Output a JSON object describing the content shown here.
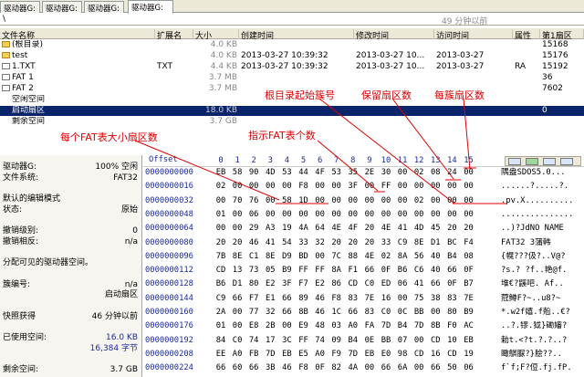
{
  "tabs": [
    {
      "label": "驱动器G:",
      "active": false
    },
    {
      "label": "驱动器G:",
      "active": false
    },
    {
      "label": "驱动器G:",
      "active": false
    },
    {
      "label": "驱动器G:",
      "active": true
    }
  ],
  "path": {
    "text": "\\",
    "time": "49 分钟以前"
  },
  "file_list": {
    "columns": [
      "文件名称",
      "扩展名",
      "大小",
      "创建时间",
      "修改时间",
      "访问时间",
      "属性",
      "第1扇区"
    ],
    "rows": [
      {
        "icon": "folder-icon",
        "name": "(根目录)",
        "ext": "",
        "size": "4.0 KB",
        "created": "",
        "modified": "",
        "accessed": "",
        "attr": "",
        "sector": "15168",
        "selected": false,
        "gray": false
      },
      {
        "icon": "folder-icon",
        "name": "test",
        "ext": "",
        "size": "4.0 KB",
        "created": "2013-03-27  10:39:32",
        "modified": "2013-03-27  10...",
        "accessed": "2013-03-27",
        "attr": "",
        "sector": "15176",
        "selected": false,
        "gray": false
      },
      {
        "icon": "file-icon",
        "name": "1.TXT",
        "ext": "TXT",
        "size": "4.4 KB",
        "created": "2013-03-27  10:39:32",
        "modified": "2013-03-27  10...",
        "accessed": "2013-03-27",
        "attr": "RA",
        "sector": "15192",
        "selected": false,
        "gray": false
      },
      {
        "icon": "file-icon",
        "name": "FAT 1",
        "ext": "",
        "size": "3.7 MB",
        "created": "",
        "modified": "",
        "accessed": "",
        "attr": "",
        "sector": "36",
        "selected": false,
        "gray": false
      },
      {
        "icon": "file-icon",
        "name": "FAT 2",
        "ext": "",
        "size": "3.7 MB",
        "created": "",
        "modified": "",
        "accessed": "",
        "attr": "",
        "sector": "7602",
        "selected": false,
        "gray": false
      },
      {
        "icon": "blank-icon",
        "name": "空闲空间",
        "ext": "",
        "size": "",
        "created": "",
        "modified": "",
        "accessed": "",
        "attr": "",
        "sector": "",
        "selected": false,
        "gray": false
      },
      {
        "icon": "blank-icon",
        "name": "启动扇区",
        "ext": "",
        "size": "18.0 KB",
        "created": "",
        "modified": "",
        "accessed": "",
        "attr": "",
        "sector": "0",
        "selected": true,
        "gray": false
      },
      {
        "icon": "blank-icon",
        "name": "剩余空间",
        "ext": "",
        "size": "3.7 GB",
        "created": "",
        "modified": "",
        "accessed": "",
        "attr": "",
        "sector": "",
        "selected": false,
        "gray": false
      }
    ]
  },
  "info_panel": [
    {
      "key": "驱动器G:",
      "value": "100% 空闲",
      "blue": false
    },
    {
      "key": "文件系统:",
      "value": "FAT32",
      "blue": false
    },
    {
      "key": "",
      "value": "",
      "blue": false
    },
    {
      "key": "默认的编辑模式",
      "value": "",
      "blue": false
    },
    {
      "key": "状态:",
      "value": "原始",
      "blue": false
    },
    {
      "key": "",
      "value": "",
      "blue": false
    },
    {
      "key": "撤销级别:",
      "value": "0",
      "blue": false
    },
    {
      "key": "撤销相反:",
      "value": "n/a",
      "blue": false
    },
    {
      "key": "",
      "value": "",
      "blue": false
    },
    {
      "key": "分配可见的驱动器空间。",
      "value": "",
      "blue": false
    },
    {
      "key": "",
      "value": "",
      "blue": false
    },
    {
      "key": "簇编号:",
      "value": "n/a",
      "blue": false
    },
    {
      "key": "",
      "value": "启动扇区",
      "blue": false
    },
    {
      "key": "",
      "value": "",
      "blue": false
    },
    {
      "key": "快照获得",
      "value": "46 分钟以前",
      "blue": false
    },
    {
      "key": "",
      "value": "",
      "blue": false
    },
    {
      "key": "已使用空间:",
      "value": "16.0 KB",
      "blue": true
    },
    {
      "key": "",
      "value": "16,384 字节",
      "blue": true
    },
    {
      "key": "",
      "value": "",
      "blue": false
    },
    {
      "key": "剩余空间:",
      "value": "3.7 GB",
      "blue": false
    }
  ],
  "hex": {
    "offset_label": "Offset",
    "col_headers": [
      "0",
      "1",
      "2",
      "3",
      "4",
      "5",
      "6",
      "7",
      "8",
      "9",
      "10",
      "11",
      "12",
      "13",
      "14",
      "15"
    ],
    "rows": [
      {
        "offset": "0000000000",
        "bytes": [
          "EB",
          "58",
          "90",
          "4D",
          "53",
          "44",
          "4F",
          "53",
          "35",
          "2E",
          "30",
          "00",
          "02",
          "08",
          "24",
          "00"
        ],
        "ascii": "隅盎SDOS5.0..."
      },
      {
        "offset": "0000000016",
        "bytes": [
          "02",
          "00",
          "00",
          "00",
          "00",
          "F8",
          "00",
          "00",
          "3F",
          "00",
          "FF",
          "00",
          "00",
          "00",
          "00",
          "00"
        ],
        "ascii": "......?.....?."
      },
      {
        "offset": "0000000032",
        "bytes": [
          "00",
          "70",
          "76",
          "00",
          "58",
          "1D",
          "00",
          "00",
          "00",
          "00",
          "00",
          "00",
          "02",
          "00",
          "00",
          "00"
        ],
        "ascii": ".pv.X.........."
      },
      {
        "offset": "0000000048",
        "bytes": [
          "01",
          "00",
          "06",
          "00",
          "00",
          "00",
          "00",
          "00",
          "00",
          "00",
          "00",
          "00",
          "00",
          "00",
          "00",
          "00"
        ],
        "ascii": "..............."
      },
      {
        "offset": "0000000064",
        "bytes": [
          "00",
          "00",
          "29",
          "A3",
          "19",
          "4A",
          "64",
          "4E",
          "4F",
          "20",
          "4E",
          "41",
          "4D",
          "45",
          "20",
          "20"
        ],
        "ascii": "..)?JdNO NAME"
      },
      {
        "offset": "0000000080",
        "bytes": [
          "20",
          "20",
          "46",
          "41",
          "54",
          "33",
          "32",
          "20",
          "20",
          "20",
          "33",
          "C9",
          "8E",
          "D1",
          "BC",
          "F4"
        ],
        "ascii": "  FAT32   3蒲韩"
      },
      {
        "offset": "0000000096",
        "bytes": [
          "7B",
          "8E",
          "C1",
          "8E",
          "D9",
          "BD",
          "00",
          "7C",
          "88",
          "4E",
          "02",
          "8A",
          "56",
          "40",
          "B4",
          "08"
        ],
        "ascii": "{幌???伋?..V@?"
      },
      {
        "offset": "0000000112",
        "bytes": [
          "CD",
          "13",
          "73",
          "05",
          "B9",
          "FF",
          "FF",
          "8A",
          "F1",
          "66",
          "0F",
          "B6",
          "C6",
          "40",
          "66",
          "0F"
        ],
        "ascii": "?s.?  ?f..艳@f."
      },
      {
        "offset": "0000000128",
        "bytes": [
          "B6",
          "D1",
          "80",
          "E2",
          "3F",
          "F7",
          "E2",
          "86",
          "CD",
          "C0",
          "ED",
          "06",
          "41",
          "66",
          "0F",
          "B7"
        ],
        "ascii": "堆€?鼷吧. Af.."
      },
      {
        "offset": "0000000144",
        "bytes": [
          "C9",
          "66",
          "F7",
          "E1",
          "66",
          "89",
          "46",
          "F8",
          "83",
          "7E",
          "16",
          "00",
          "75",
          "38",
          "83",
          "7E"
        ],
        "ascii": "蒄鳟F?~..u8?~"
      },
      {
        "offset": "0000000160",
        "bytes": [
          "2A",
          "00",
          "77",
          "32",
          "66",
          "8B",
          "46",
          "1C",
          "66",
          "83",
          "C0",
          "0C",
          "BB",
          "00",
          "80",
          "B9"
        ],
        "ascii": "*.w2f嬉.f兝..€?"
      },
      {
        "offset": "0000000176",
        "bytes": [
          "01",
          "00",
          "E8",
          "2B",
          "00",
          "E9",
          "48",
          "03",
          "A0",
          "FA",
          "7D",
          "B4",
          "7D",
          "8B",
          "F0",
          "AC"
        ],
        "ascii": "..?.镠.狘}磡嬸?"
      },
      {
        "offset": "0000000192",
        "bytes": [
          "84",
          "C0",
          "74",
          "17",
          "3C",
          "FF",
          "74",
          "09",
          "B4",
          "0E",
          "BB",
          "07",
          "00",
          "CD",
          "10",
          "EB"
        ],
        "ascii": "勅t.<?t.?.?..?"
      },
      {
        "offset": "0000000208",
        "bytes": [
          "EE",
          "A0",
          "FB",
          "7D",
          "EB",
          "E5",
          "A0",
          "F9",
          "7D",
          "EB",
          "E0",
          "98",
          "CD",
          "16",
          "CD",
          "19"
        ],
        "ascii": "瞰鶀脲?}脍??.."
      },
      {
        "offset": "0000000224",
        "bytes": [
          "66",
          "60",
          "66",
          "3B",
          "46",
          "F8",
          "0F",
          "82",
          "4A",
          "00",
          "66",
          "6A",
          "00",
          "66",
          "50",
          "06"
        ],
        "ascii": "f`f;F?侸.fj.fP."
      }
    ]
  },
  "annotations": {
    "root_start_cluster": "根目录起始簇号",
    "reserved_sectors": "保留扇区数",
    "sectors_per_cluster": "每簇扇区数",
    "fat_size": "每个FAT表大小扇区数",
    "num_fats": "指示FAT表个数"
  },
  "colors": {
    "selection": "#0a246a",
    "annotation": "#e00000",
    "offset_blue": "#1a2aa0",
    "chrome": "#ece9d8"
  }
}
